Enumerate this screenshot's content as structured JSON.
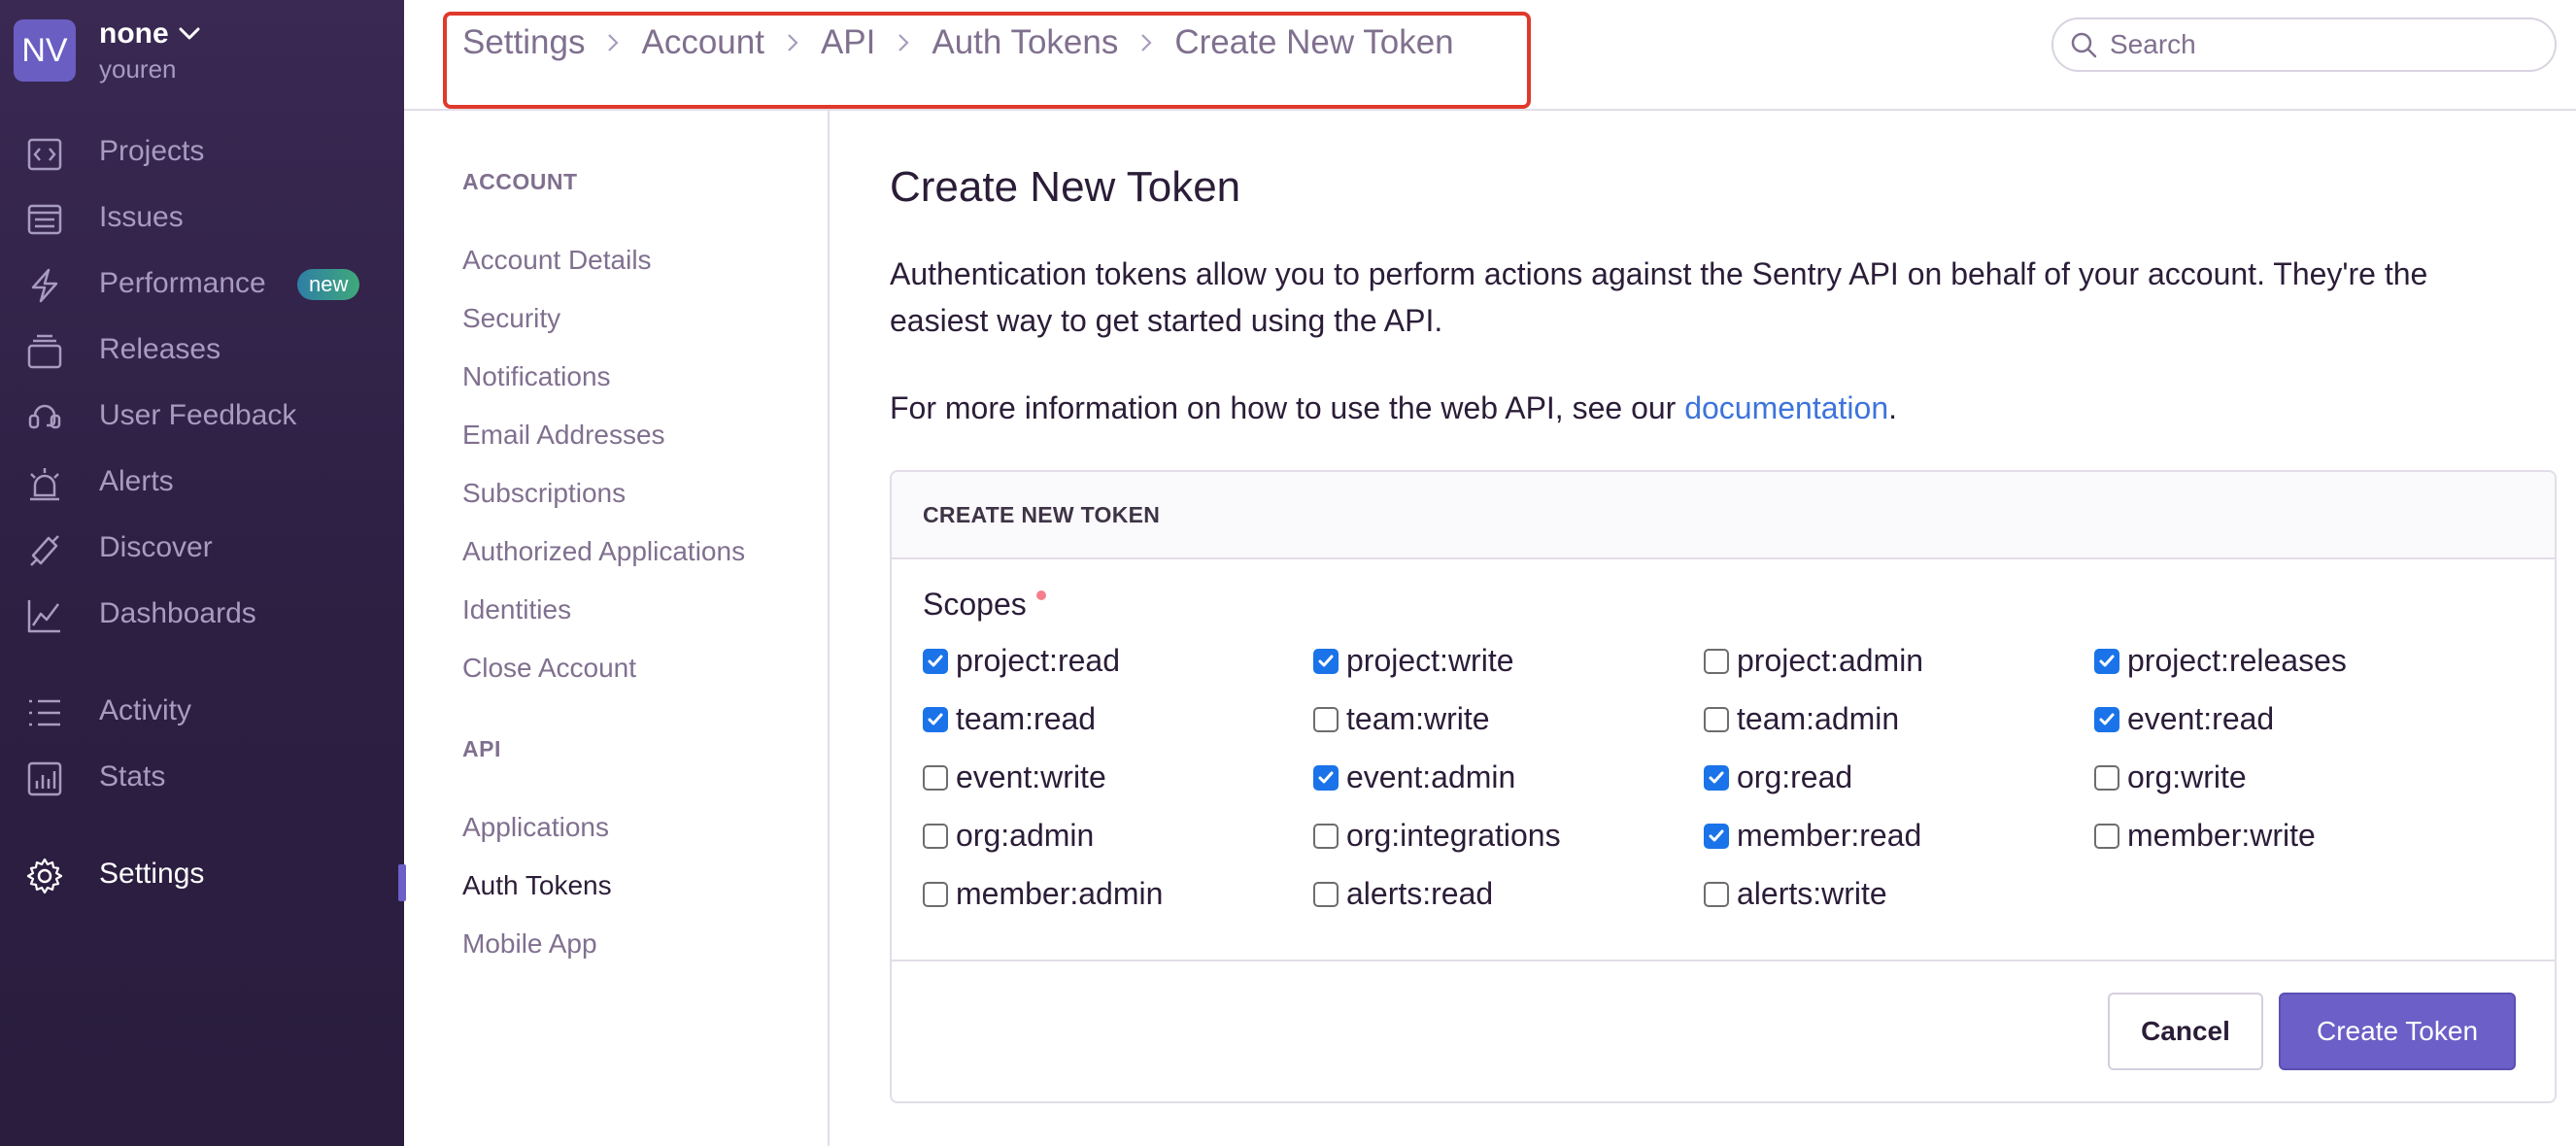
{
  "org": {
    "initials": "NV",
    "name": "none",
    "user": "youren"
  },
  "sidebar": {
    "items": [
      {
        "label": "Projects",
        "icon": "projects-icon"
      },
      {
        "label": "Issues",
        "icon": "issues-icon"
      },
      {
        "label": "Performance",
        "icon": "performance-icon",
        "badge": "new"
      },
      {
        "label": "Releases",
        "icon": "releases-icon"
      },
      {
        "label": "User Feedback",
        "icon": "user-feedback-icon"
      },
      {
        "label": "Alerts",
        "icon": "alerts-icon"
      },
      {
        "label": "Discover",
        "icon": "discover-icon"
      },
      {
        "label": "Dashboards",
        "icon": "dashboards-icon"
      },
      {
        "label": "Activity",
        "icon": "activity-icon"
      },
      {
        "label": "Stats",
        "icon": "stats-icon"
      },
      {
        "label": "Settings",
        "icon": "settings-icon",
        "active": true
      }
    ]
  },
  "breadcrumb": [
    "Settings",
    "Account",
    "API",
    "Auth Tokens",
    "Create New Token"
  ],
  "search": {
    "placeholder": "Search"
  },
  "settings_nav": {
    "account_heading": "ACCOUNT",
    "account_links": [
      "Account Details",
      "Security",
      "Notifications",
      "Email Addresses",
      "Subscriptions",
      "Authorized Applications",
      "Identities",
      "Close Account"
    ],
    "api_heading": "API",
    "api_links": [
      "Applications",
      "Auth Tokens",
      "Mobile App"
    ],
    "active": "Auth Tokens"
  },
  "main": {
    "title": "Create New Token",
    "description": "Authentication tokens allow you to perform actions against the Sentry API on behalf of your account. They're the easiest way to get started using the API.",
    "info_prefix": "For more information on how to use the web API, see our ",
    "info_link": "documentation",
    "info_suffix": "."
  },
  "panel": {
    "header": "CREATE NEW TOKEN",
    "scopes_label": "Scopes",
    "scopes": [
      {
        "name": "project:read",
        "checked": true
      },
      {
        "name": "project:write",
        "checked": true
      },
      {
        "name": "project:admin",
        "checked": false
      },
      {
        "name": "project:releases",
        "checked": true
      },
      {
        "name": "team:read",
        "checked": true
      },
      {
        "name": "team:write",
        "checked": false
      },
      {
        "name": "team:admin",
        "checked": false
      },
      {
        "name": "event:read",
        "checked": true
      },
      {
        "name": "event:write",
        "checked": false
      },
      {
        "name": "event:admin",
        "checked": true
      },
      {
        "name": "org:read",
        "checked": true
      },
      {
        "name": "org:write",
        "checked": false
      },
      {
        "name": "org:admin",
        "checked": false
      },
      {
        "name": "org:integrations",
        "checked": false
      },
      {
        "name": "member:read",
        "checked": true
      },
      {
        "name": "member:write",
        "checked": false
      },
      {
        "name": "member:admin",
        "checked": false
      },
      {
        "name": "alerts:read",
        "checked": false
      },
      {
        "name": "alerts:write",
        "checked": false
      }
    ],
    "cancel_label": "Cancel",
    "create_label": "Create Token"
  },
  "colors": {
    "sidebar": "#2c1f42",
    "accent": "#6c5fc7",
    "link": "#3d74db",
    "highlight": "#e0392b",
    "checkbox": "#1a73e8"
  }
}
